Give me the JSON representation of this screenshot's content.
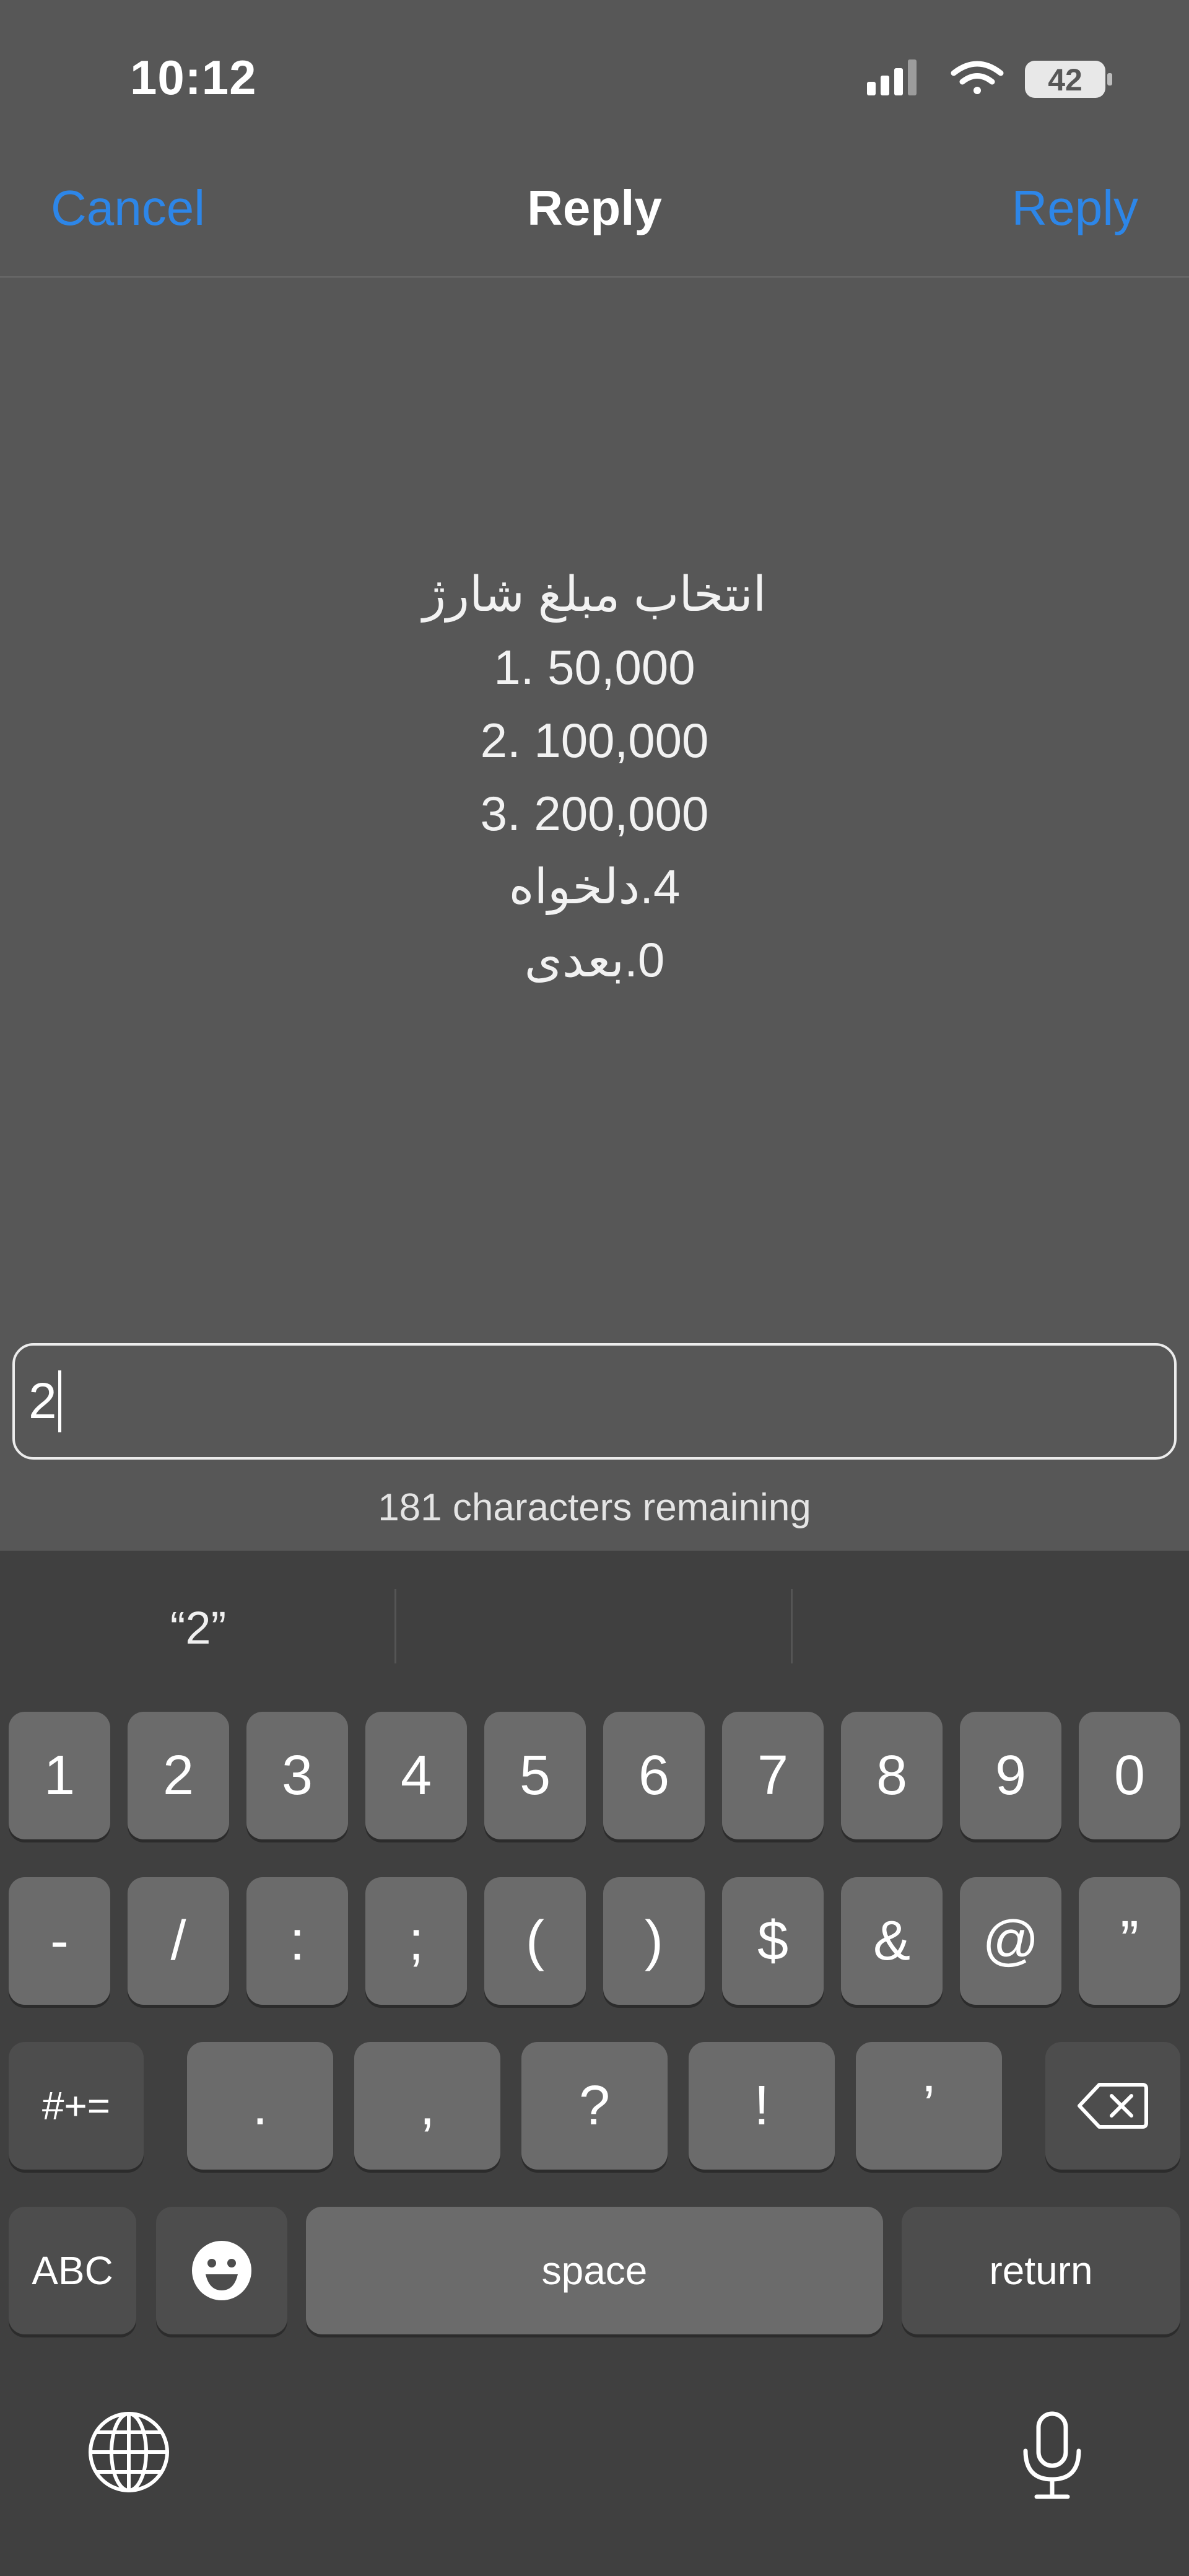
{
  "status_bar": {
    "time": "10:12",
    "battery": "42",
    "icons": [
      "signal-icon",
      "wifi-icon",
      "battery-icon"
    ]
  },
  "nav": {
    "cancel_label": "Cancel",
    "title": "Reply",
    "reply_label": "Reply"
  },
  "message": {
    "lines": [
      "انتخاب مبلغ شارژ",
      "1. 50,000",
      "2. 100,000",
      "3. 200,000",
      "4.دلخواه",
      "0.بعدی"
    ]
  },
  "reply_input": {
    "value": "2"
  },
  "counter": "181 characters remaining",
  "keyboard": {
    "suggestions": [
      "“2”",
      "",
      ""
    ],
    "row1": [
      "1",
      "2",
      "3",
      "4",
      "5",
      "6",
      "7",
      "8",
      "9",
      "0"
    ],
    "row2": [
      "-",
      "/",
      ":",
      ";",
      "(",
      ")",
      "$",
      "&",
      "@",
      "”"
    ],
    "row3": [
      "#+=",
      ".",
      ",",
      "?",
      "!",
      "’"
    ],
    "row4": {
      "abc": "ABC",
      "space": "space",
      "return": "return"
    }
  },
  "colors": {
    "accent": "#2d86e8",
    "background": "#575757",
    "keyboard_bg": "#404040",
    "key": "#6b6b6b"
  }
}
